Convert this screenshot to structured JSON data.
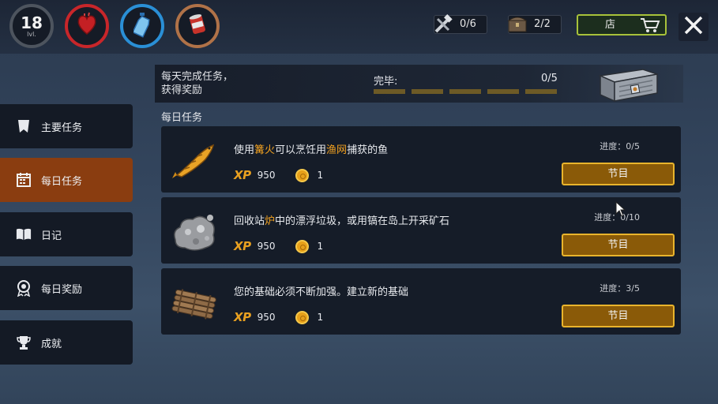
{
  "stats": {
    "level": "18",
    "level_label": "lvl."
  },
  "counters": {
    "tools": "0/6",
    "chests": "2/2"
  },
  "shop_label": "店",
  "daily": {
    "desc_line1": "每天完成任务，",
    "desc_line2": "获得奖励",
    "done_label": "完毕:",
    "done_count": "0/5"
  },
  "section_title": "每日任务",
  "sidebar": {
    "items": [
      {
        "label": "主要任务"
      },
      {
        "label": "每日任务"
      },
      {
        "label": "日记"
      },
      {
        "label": "每日奖励"
      },
      {
        "label": "成就"
      }
    ]
  },
  "quests": [
    {
      "text_a": "使用",
      "hl1": "篝火",
      "text_b": "可以烹饪用",
      "hl2": "渔网",
      "text_c": "捕获的鱼",
      "xp_label": "XP",
      "xp": "950",
      "coins": "1",
      "progress": "进度：0/5",
      "button": "节目"
    },
    {
      "text_a": "回收站",
      "hl1": "炉",
      "text_b": "中的漂浮垃圾，或用镐在岛上开采矿石",
      "xp_label": "XP",
      "xp": "950",
      "coins": "1",
      "progress": "进度：0/10",
      "button": "节目"
    },
    {
      "text_a": "您的基础必须不断加强。建立新的基础",
      "xp_label": "XP",
      "xp": "950",
      "coins": "1",
      "progress": "进度：3/5",
      "button": "节目"
    }
  ],
  "colors": {
    "accent_orange": "#f0a020",
    "active_tab": "#8a3d10",
    "button_border": "#e9b42c"
  }
}
